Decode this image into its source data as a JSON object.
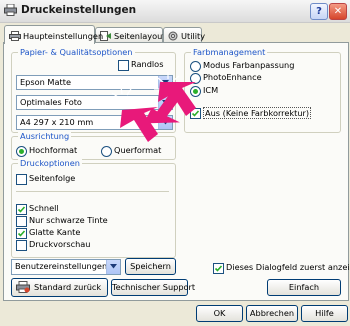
{
  "window": {
    "title": "Druckeinstellungen",
    "help_glyph": "?",
    "close_glyph": "✕"
  },
  "tabs": [
    {
      "label": "Haupteinstellungen",
      "icon": "printer-icon",
      "active": true
    },
    {
      "label": "Seitenlayout",
      "icon": "page-layout-icon",
      "active": false
    },
    {
      "label": "Utility",
      "icon": "utility-icon",
      "active": false
    }
  ],
  "paper": {
    "group_title": "Papier- & Qualitätsoptionen",
    "borderless_label": "Randlos",
    "borderless_checked": false,
    "paper_type": "Epson Matte",
    "quality": "Optimales Foto",
    "size": "A4 297 x 210 mm"
  },
  "color": {
    "group_title": "Farbmanagement",
    "options": [
      "Modus Farbanpassung",
      "PhotoEnhance",
      "ICM"
    ],
    "selected": "ICM",
    "icm_off_label": "Aus (Keine Farbkorrektur)",
    "icm_off_checked": true
  },
  "orientation": {
    "group_title": "Ausrichtung",
    "portrait_label": "Hochformat",
    "landscape_label": "Querformat",
    "selected": "portrait"
  },
  "print_options": {
    "group_title": "Druckoptionen",
    "page_order_label": "Seitenfolge",
    "page_order_checked": false,
    "items": [
      {
        "label": "Schnell",
        "checked": true
      },
      {
        "label": "Nur schwarze Tinte",
        "checked": false
      },
      {
        "label": "Glatte Kante",
        "checked": true
      },
      {
        "label": "Druckvorschau",
        "checked": false
      }
    ]
  },
  "bottom": {
    "preset": "Benutzereinstellungen",
    "save_label": "Speichern",
    "reset_label": "Standard zurück",
    "support_label": "Technischer Support",
    "show_first_label": "Dieses Dialogfeld zuerst anzeigen",
    "show_first_checked": true,
    "simple_label": "Einfach"
  },
  "footer": {
    "ok": "OK",
    "cancel": "Abbrechen",
    "help": "Hilfe"
  },
  "colors": {
    "accent": "#1e56c8",
    "pointer": "#e8197a",
    "check": "#2aaf2a"
  }
}
